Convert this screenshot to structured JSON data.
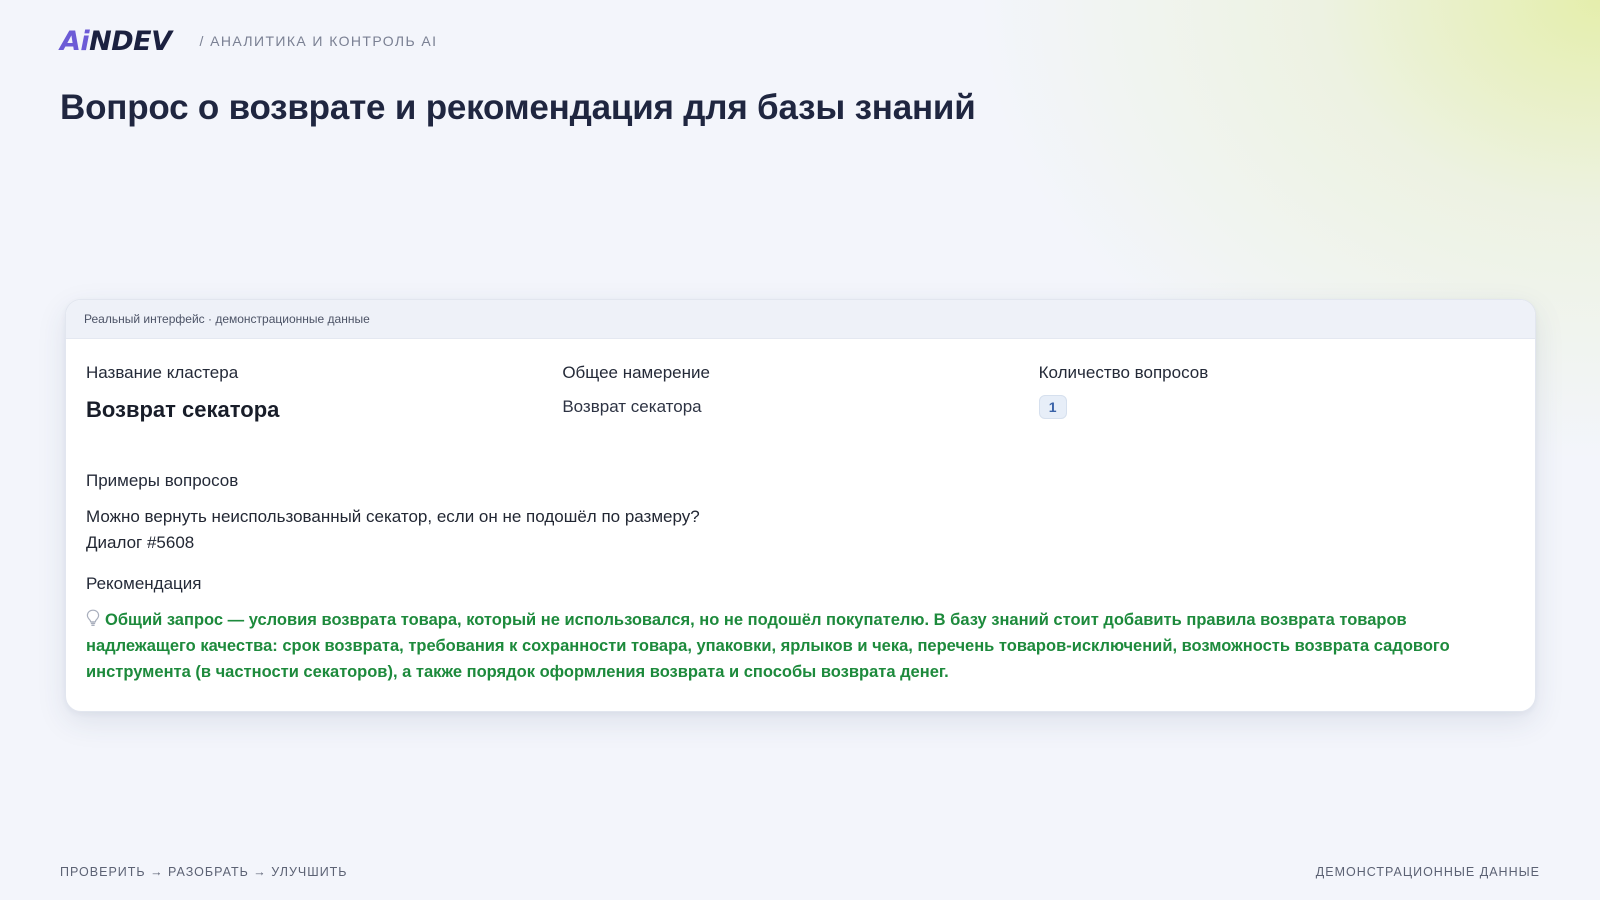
{
  "header": {
    "logo_ai": "Ai",
    "logo_ndev": "NDEV",
    "subtitle": "/ АНАЛИТИКА И КОНТРОЛЬ AI"
  },
  "page_title": "Вопрос о возврате и рекомендация для базы знаний",
  "card": {
    "topbar_text": "Реальный интерфейс · демонстрационные данные",
    "cluster": {
      "label": "Название кластера",
      "value": "Возврат секатора"
    },
    "intent": {
      "label": "Общее намерение",
      "value": "Возврат секатора"
    },
    "question_count": {
      "label": "Количество вопросов",
      "value": "1"
    },
    "examples": {
      "label": "Примеры вопросов",
      "question": "Можно вернуть неиспользованный секатор, если он не подошёл по размеру?",
      "dialog": "Диалог #5608"
    },
    "recommendation": {
      "label": "Рекомендация",
      "icon": "lightbulb-icon",
      "text": "Общий запрос — условия возврата товара, который не использовался, но не подошёл покупателю. В базу знаний стоит добавить правила возврата товаров надлежащего качества: срок возврата, требования к сохранности товара, упаковки, ярлыков и чека, перечень товаров-исключений, возможность возврата садового инструмента (в частности секаторов), а также порядок оформления возврата и способы возврата денег."
    }
  },
  "footer": {
    "left": "ПРОВЕРИТЬ → РАЗОБРАТЬ → УЛУЧШИТЬ",
    "right": "ДЕМОНСТРАЦИОННЫЕ ДАННЫЕ"
  },
  "colors": {
    "logo_accent": "#6c5bd6",
    "logo_dark": "#1b2140",
    "recommendation_green": "#1d8a3c",
    "badge_blue": "#3a63a8"
  }
}
